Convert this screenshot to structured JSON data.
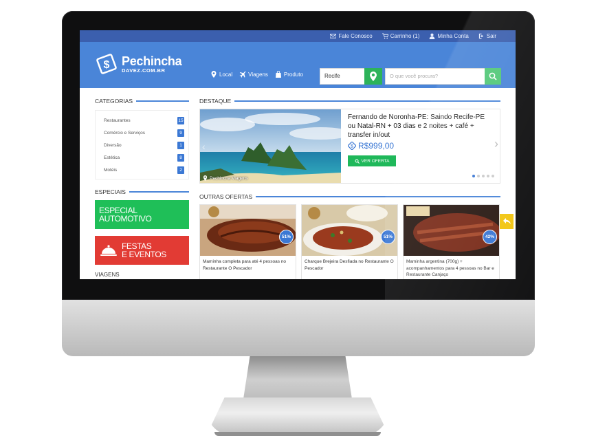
{
  "topbar": {
    "links": [
      {
        "label": "Fale Conosco",
        "icon": "envelope-icon"
      },
      {
        "label": "Carrinho (1)",
        "icon": "cart-icon"
      },
      {
        "label": "Minha Conta",
        "icon": "user-icon"
      },
      {
        "label": "Sair",
        "icon": "logout-icon"
      }
    ]
  },
  "header": {
    "logo_title": "Pechincha",
    "logo_sub": "DAVEZ.COM.BR",
    "nav": [
      {
        "label": "Local",
        "icon": "map-pin-icon"
      },
      {
        "label": "Viagens",
        "icon": "airplane-icon"
      },
      {
        "label": "Produto",
        "icon": "shopping-bag-icon"
      }
    ],
    "city_value": "Recife",
    "search_placeholder": "O que você procura?"
  },
  "sidebar": {
    "categories_title": "CATEGORIAS",
    "categories": [
      {
        "label": "Restaurantes",
        "count": "15"
      },
      {
        "label": "Comércio e Serviços",
        "count": "9"
      },
      {
        "label": "Diversão",
        "count": "1"
      },
      {
        "label": "Estética",
        "count": "8"
      },
      {
        "label": "Motéis",
        "count": "2"
      }
    ],
    "especiais_title": "ESPECIAIS",
    "promo1_line1": "ESPECIAL",
    "promo1_line2": "AUTOMOTIVO",
    "promo2_line1": "FESTAS",
    "promo2_line2": "E EVENTOS",
    "viagens_title": "VIAGENS"
  },
  "featured": {
    "section_title": "DESTAQUE",
    "tag": "Pechincha Viagens",
    "title": "Fernando de Noronha-PE: Saindo Recife-PE ou Natal-RN + 03 dias e 2 noites + café + transfer in/out",
    "price": "R$999,00",
    "cta": "VER OFERTA",
    "slide_count": 5,
    "active_slide": 0
  },
  "offers": {
    "section_title": "OUTRAS OFERTAS",
    "items": [
      {
        "discount": "51%",
        "text": "Maminha completa para até 4 pessoas no Restaurante O Pescador"
      },
      {
        "discount": "51%",
        "text": "Charque Brejeira Desfiada no Restaurante O Pescador"
      },
      {
        "discount": "42%",
        "text": "Maminha argentina (700g) + acompanhamentos para 4 pessoas no Bar e Restaurante Canjaço"
      }
    ]
  },
  "colors": {
    "brand_blue": "#4a85d8",
    "topbar_blue": "#3b5fae",
    "green": "#1fbf58",
    "red": "#e23b34",
    "yellow": "#f2c511"
  }
}
